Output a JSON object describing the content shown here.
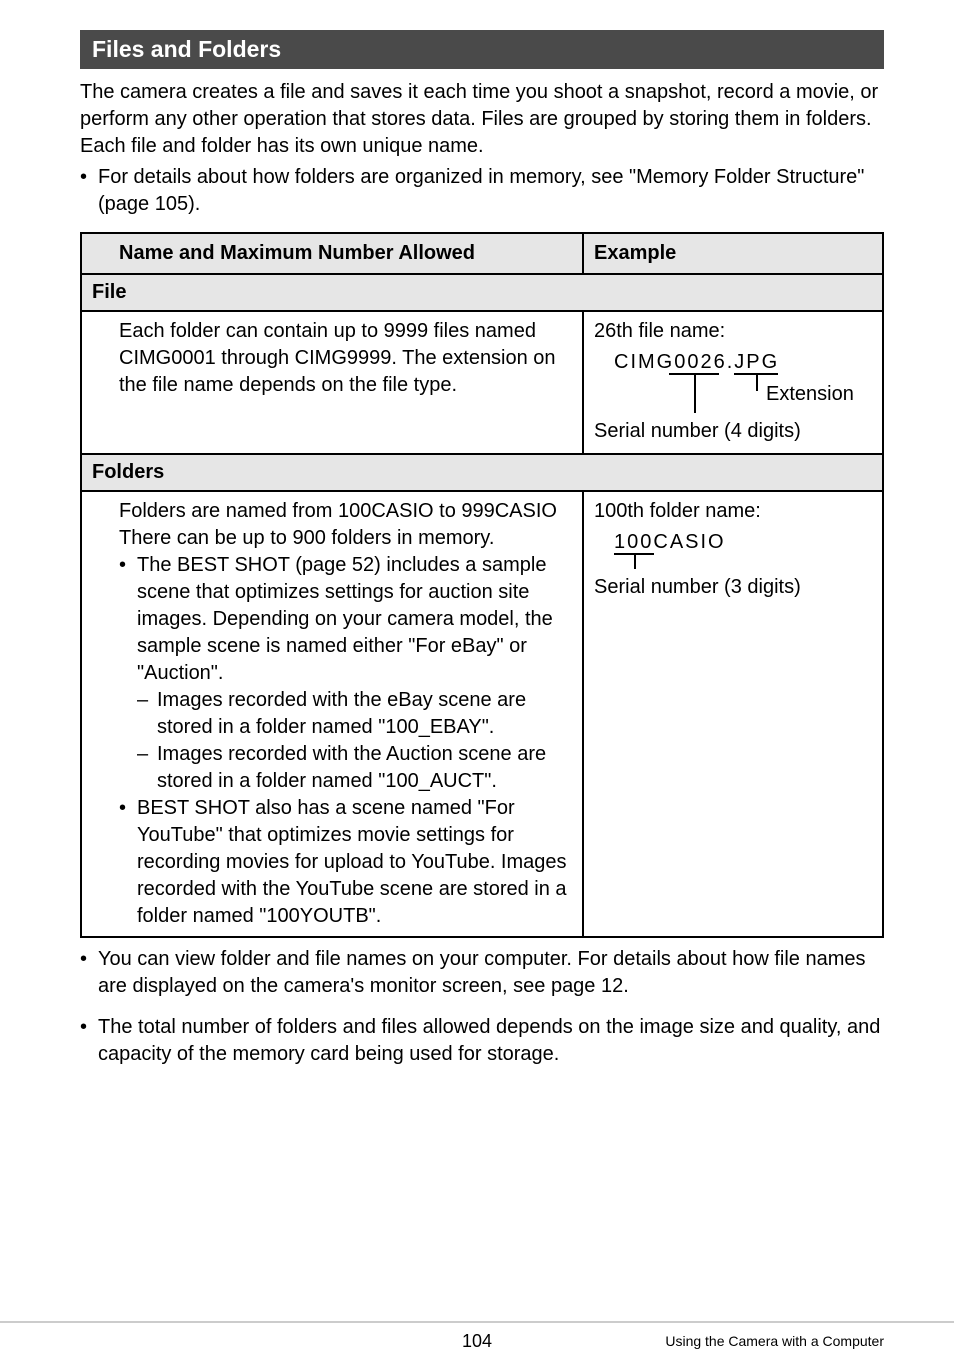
{
  "header": {
    "title": "Files and Folders"
  },
  "intro": {
    "para": "The camera creates a file and saves it each time you shoot a snapshot, record a movie, or perform any other operation that stores data. Files are grouped by storing them in folders. Each file and folder has its own unique name.",
    "bullet": "For details about how folders are organized in memory, see \"Memory Folder Structure\" (page 105)."
  },
  "table": {
    "h1": "Name and Maximum Number Allowed",
    "h2": "Example",
    "file_header": "File",
    "file_desc": "Each folder can contain up to 9999 files named CIMG0001 through CIMG9999. The extension on the file name depends on the file type.",
    "file_example_title": "26th file name:",
    "file_example_name": "CIMG0026.JPG",
    "file_example_ext": "Extension",
    "file_example_serial": "Serial number (4 digits)",
    "folders_header": "Folders",
    "folders_p1": "Folders are named from 100CASIO to 999CASIO",
    "folders_p2": "There can be up to 900 folders in memory.",
    "folders_b1": "The BEST SHOT (page 52) includes a sample scene that optimizes settings for auction site images. Depending on your camera model, the sample scene is named either \"For eBay\" or \"Auction\".",
    "folders_d1": "Images recorded with the eBay scene are stored in a folder named \"100_EBAY\".",
    "folders_d2": "Images recorded with the Auction scene are stored in a folder named \"100_AUCT\".",
    "folders_b2": "BEST SHOT also has a scene named \"For YouTube\" that optimizes movie settings for recording movies for upload to YouTube. Images recorded with the YouTube scene are stored in a folder named \"100YOUTB\".",
    "folder_example_title": "100th folder name:",
    "folder_example_name": "100CASIO",
    "folder_example_serial": "Serial number (3 digits)"
  },
  "notes": {
    "n1": "You can view folder and file names on your computer. For details about how file names are displayed on the camera's monitor screen, see page 12.",
    "n2": "The total number of folders and files allowed depends on the image size and quality, and capacity of the memory card being used for storage."
  },
  "footer": {
    "page": "104",
    "section": "Using the Camera with a Computer"
  }
}
